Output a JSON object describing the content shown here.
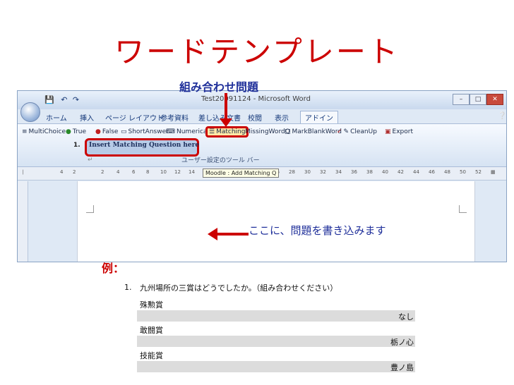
{
  "slide": {
    "title": "ワードテンプレート",
    "callout_label": "組み合わせ問題",
    "note_text": "ここに、問題を書き込みます",
    "example_label": "例：",
    "colors": {
      "title": "#cc0000",
      "callout": "#1f2f9a",
      "arrow": "#cc0000"
    }
  },
  "word": {
    "window_title": "Test20091124 - Microsoft Word",
    "qat_icons": [
      "save-icon",
      "undo-icon",
      "redo-icon"
    ],
    "tabs": [
      "ホーム",
      "挿入",
      "ページ レイアウト",
      "参考資料",
      "差し込み文書",
      "校閲",
      "表示",
      "アドイン"
    ],
    "ribbon_buttons": [
      "MultiChoice",
      "True",
      "False",
      "ShortAnswer",
      "Numerical",
      "Matching",
      "MissingWordQ",
      "MarkBlankWord",
      "CleanUp",
      "Export"
    ],
    "ribbon_group_label": "ユーザー設定のツール バー",
    "ruler_tooltip": "Moodle : Add Matching Q",
    "ruler_numbers": [
      "4",
      "2",
      "2",
      "4",
      "6",
      "8",
      "10",
      "12",
      "14",
      "16",
      "36",
      "28",
      "30",
      "32",
      "34",
      "36",
      "38",
      "40",
      "42",
      "44",
      "46",
      "48",
      "50",
      "52"
    ],
    "question_number": "1.",
    "question_placeholder": "Insert Matching Question here"
  },
  "example": {
    "question_number": "1.",
    "question": "九州場所の三賞はどうでしたか。（組み合わせください）",
    "items": [
      {
        "prize": "殊勲賞",
        "answer": "なし"
      },
      {
        "prize": "敢闘賞",
        "answer": "栃ノ心"
      },
      {
        "prize": "技能賞",
        "answer": "豊ノ島"
      }
    ]
  }
}
